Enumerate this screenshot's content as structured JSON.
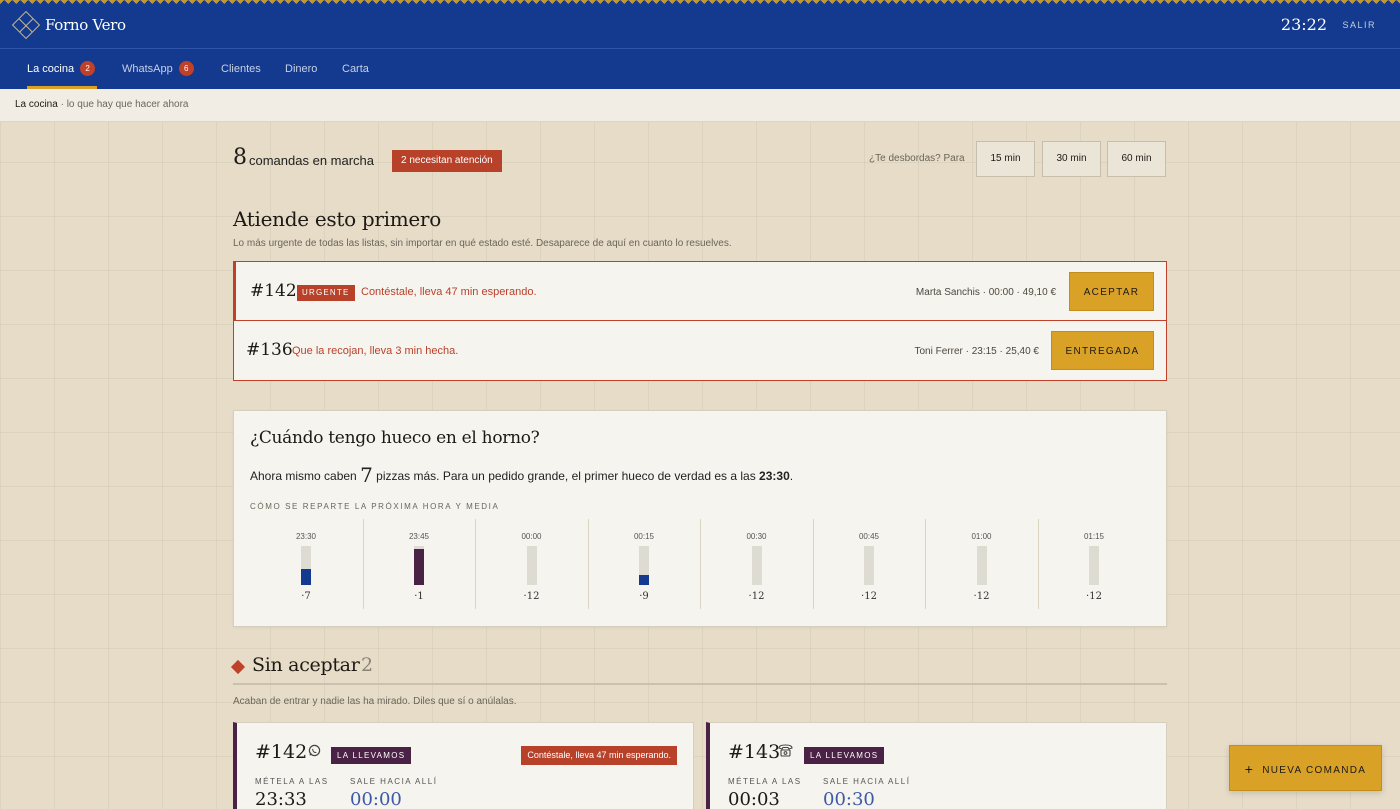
{
  "app": {
    "brand": "Forno Vero",
    "clock": "23:22",
    "logout": "SALIR"
  },
  "nav": {
    "items": [
      {
        "label": "La cocina",
        "badge": "2"
      },
      {
        "label": "WhatsApp",
        "badge": "6"
      },
      {
        "label": "Clientes"
      },
      {
        "label": "Dinero"
      },
      {
        "label": "Carta"
      }
    ]
  },
  "breadcrumb": {
    "current": "La cocina",
    "rest": " · lo que hay que hacer ahora"
  },
  "summary": {
    "count": "8",
    "count_label": "comandas en marcha",
    "attention": "2 necesitan atención",
    "overflow_label": "¿Te desbordas? Para",
    "slots": [
      "15 min",
      "30 min",
      "60 min"
    ]
  },
  "priority": {
    "title": "Atiende esto primero",
    "subtitle": "Lo más urgente de todas las listas, sin importar en qué estado esté. Desaparece de aquí en cuanto lo resuelves.",
    "items": [
      {
        "num": "#142",
        "tag": "URGENTE",
        "message": "Contéstale, lleva 47 min esperando.",
        "meta": "Marta Sanchis · 00:00 · 49,10 €",
        "action": "ACEPTAR"
      },
      {
        "num": "#136",
        "message": "Que la recojan, lleva 3 min hecha.",
        "meta": "Toni Ferrer · 23:15 · 25,40 €",
        "action": "ENTREGADA"
      }
    ]
  },
  "oven": {
    "title": "¿Cuándo tengo hueco en el horno?",
    "line_pre": "Ahora mismo caben",
    "line_num": "7",
    "line_mid": "pizzas más. Para un pedido grande, el primer hueco de verdad es a las",
    "line_time": "23:30",
    "line_end": ".",
    "caption": "CÓMO SE REPARTE LA PRÓXIMA HORA Y MEDIA",
    "capacity": 12,
    "slots": [
      {
        "time": "23:30",
        "free": "·7",
        "used": 5,
        "color": "#133a8e"
      },
      {
        "time": "23:45",
        "free": "·1",
        "used": 11,
        "color": "#4a2245"
      },
      {
        "time": "00:00",
        "free": "·12",
        "used": 0,
        "color": "#133a8e"
      },
      {
        "time": "00:15",
        "free": "·9",
        "used": 3,
        "color": "#133a8e"
      },
      {
        "time": "00:30",
        "free": "·12",
        "used": 0,
        "color": "#133a8e"
      },
      {
        "time": "00:45",
        "free": "·12",
        "used": 0,
        "color": "#133a8e"
      },
      {
        "time": "01:00",
        "free": "·12",
        "used": 0,
        "color": "#133a8e"
      },
      {
        "time": "01:15",
        "free": "·12",
        "used": 0,
        "color": "#133a8e"
      }
    ]
  },
  "unaccepted": {
    "title": "Sin aceptar",
    "count": "2",
    "subtitle": "Acaban de entrar y nadie las ha mirado. Diles que sí o anúlalas.",
    "orders": [
      {
        "num": "#142",
        "icon": "whatsapp-icon",
        "tag": "LA LLEVAMOS",
        "alert": "Contéstale, lleva 47 min esperando.",
        "label_in": "MÉTELA A LAS",
        "value_in": "23:33",
        "label_out": "SALE HACIA ALLÍ",
        "value_out": "00:00"
      },
      {
        "num": "#143",
        "icon": "phone-icon",
        "tag": "LA LLEVAMOS",
        "alert": "",
        "label_in": "MÉTELA A LAS",
        "value_in": "00:03",
        "label_out": "SALE HACIA ALLÍ",
        "value_out": "00:30"
      }
    ]
  },
  "fab": {
    "label": "NUEVA COMANDA"
  }
}
